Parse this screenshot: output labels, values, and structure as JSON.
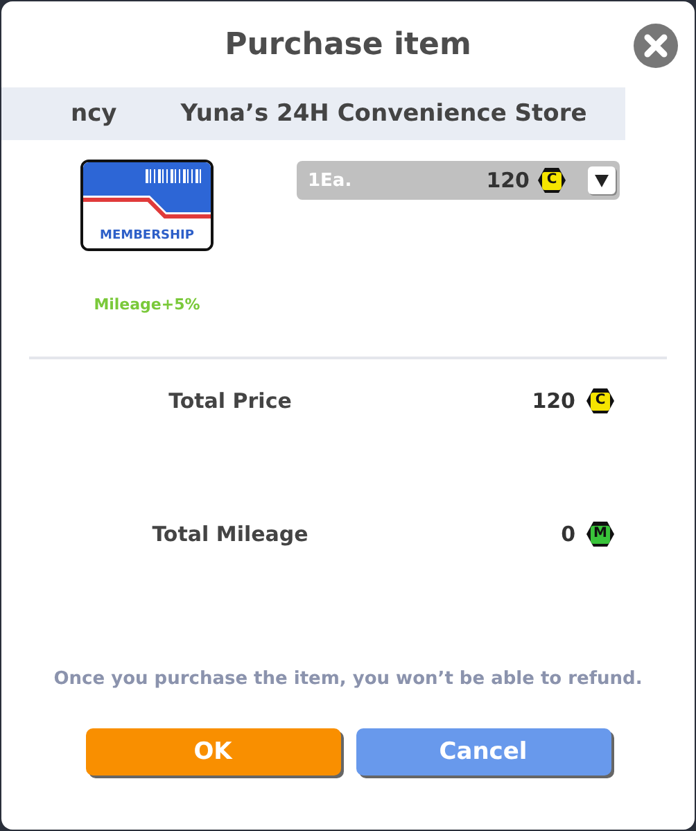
{
  "title": "Purchase item",
  "marquee": [
    "ncy",
    "Yuna’s 24H Convenience Store"
  ],
  "item": {
    "card_label": "MEMBERSHIP",
    "bonus": "Mileage+5%"
  },
  "quantity": {
    "value": "1Ea.",
    "price": "120",
    "currency": "C"
  },
  "totals": [
    {
      "label": "Total Price",
      "value": "120",
      "currency": "C",
      "kind": "coin"
    },
    {
      "label": "Total Mileage",
      "value": "0",
      "currency": "M",
      "kind": "mileage"
    }
  ],
  "notice": "Once you purchase the item, you won’t be able to refund.",
  "buttons": [
    {
      "label": "OK",
      "kind": "primary"
    },
    {
      "label": "Cancel",
      "kind": "secondary"
    }
  ]
}
